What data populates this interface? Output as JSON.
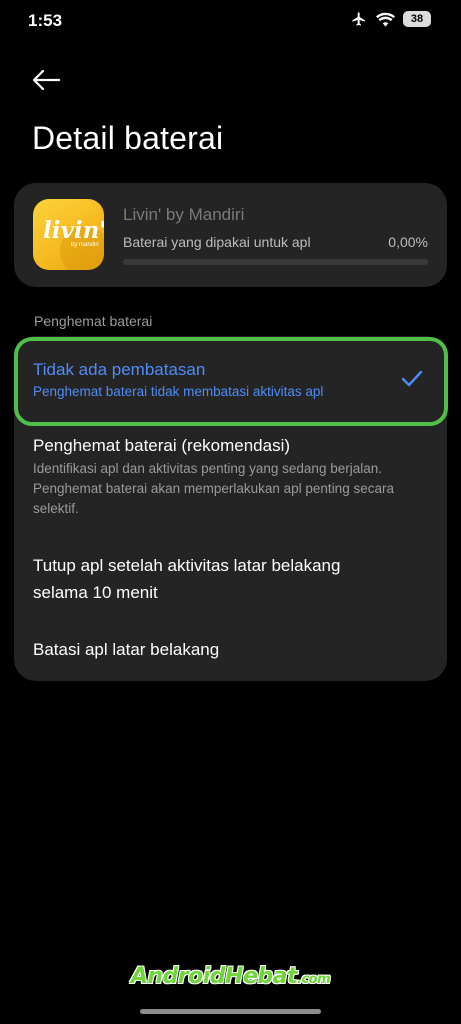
{
  "status_bar": {
    "time": "1:53",
    "battery_level": "38",
    "icons": [
      "airplane-icon",
      "wifi-icon",
      "battery-icon"
    ]
  },
  "header": {
    "back_icon": "arrow-left-icon",
    "title": "Detail baterai"
  },
  "app_card": {
    "app_icon_text": "livin'",
    "app_icon_subtext": "by mandiri",
    "app_name": "Livin' by Mandiri",
    "usage_label": "Baterai yang dipakai untuk apl",
    "usage_value": "0,00%",
    "usage_fraction": 0.0
  },
  "battery_saver": {
    "section_label": "Penghemat baterai",
    "options": [
      {
        "title": "Tidak ada pembatasan",
        "description": "Penghemat baterai tidak membatasi aktivitas apl",
        "selected": true
      },
      {
        "title": "Penghemat baterai (rekomendasi)",
        "description": "Identifikasi apl dan aktivitas penting yang sedang berjalan. Penghemat baterai akan memperlakukan apl penting secara selektif.",
        "selected": false
      },
      {
        "title": "Tutup apl setelah aktivitas latar belakang selama 10 menit",
        "description": "",
        "selected": false
      },
      {
        "title": "Batasi apl latar belakang",
        "description": "",
        "selected": false
      }
    ]
  },
  "watermark": {
    "main": "AndroidHebat",
    "suffix": ".com"
  },
  "colors": {
    "accent": "#4f8cf7",
    "highlight_outline": "#4fbf4a",
    "card_background": "#242424",
    "background": "#000000"
  }
}
